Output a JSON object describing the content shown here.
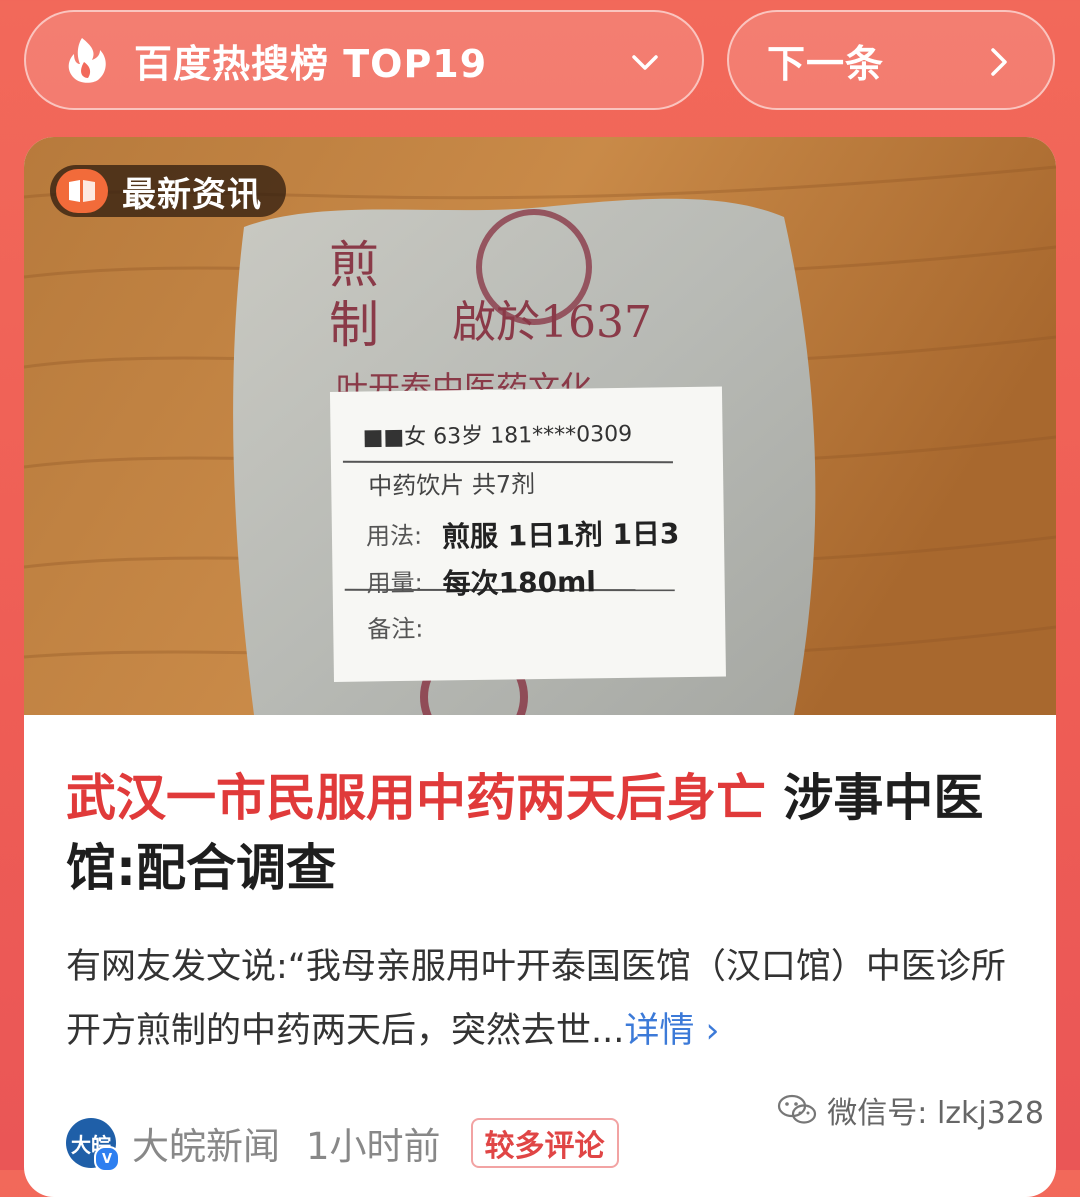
{
  "topbar": {
    "rank_label": "百度热搜榜 TOP19",
    "next_label": "下一条"
  },
  "card": {
    "badge_label": "最新资讯",
    "photo": {
      "package_text_1": "煎",
      "package_text_2": "制",
      "package_text_3": "啟於1637",
      "package_text_4": "叶开泰中医药文化",
      "label_line_1": "■■女 63岁 181****0309",
      "label_line_2": "中药饮片  共7剂",
      "label_line_3_key": "用法:",
      "label_line_3_val": "煎服  1日1剂  1日3",
      "label_line_4_key": "用量:",
      "label_line_4_val": "每次180ml",
      "label_line_5_key": "备注:"
    },
    "headline_highlight": "武汉一市民服用中药两天后身亡",
    "headline_rest": " 涉事中医馆:配合调查",
    "summary": "有网友发文说:“我母亲服用叶开泰国医馆（汉口馆）中医诊所开方煎制的中药两天后，突然去世...",
    "more_label": "详情 ›",
    "source": "大皖新闻",
    "avatar_text": "大皖",
    "verified": "V",
    "time": "1小时前",
    "tag": "较多评论"
  },
  "watermark": "微信号: lzkj328",
  "colors": {
    "background": "#ee5d55",
    "headline_highlight": "#e03a3a",
    "link": "#3c7ad8",
    "tag": "#e04545"
  }
}
